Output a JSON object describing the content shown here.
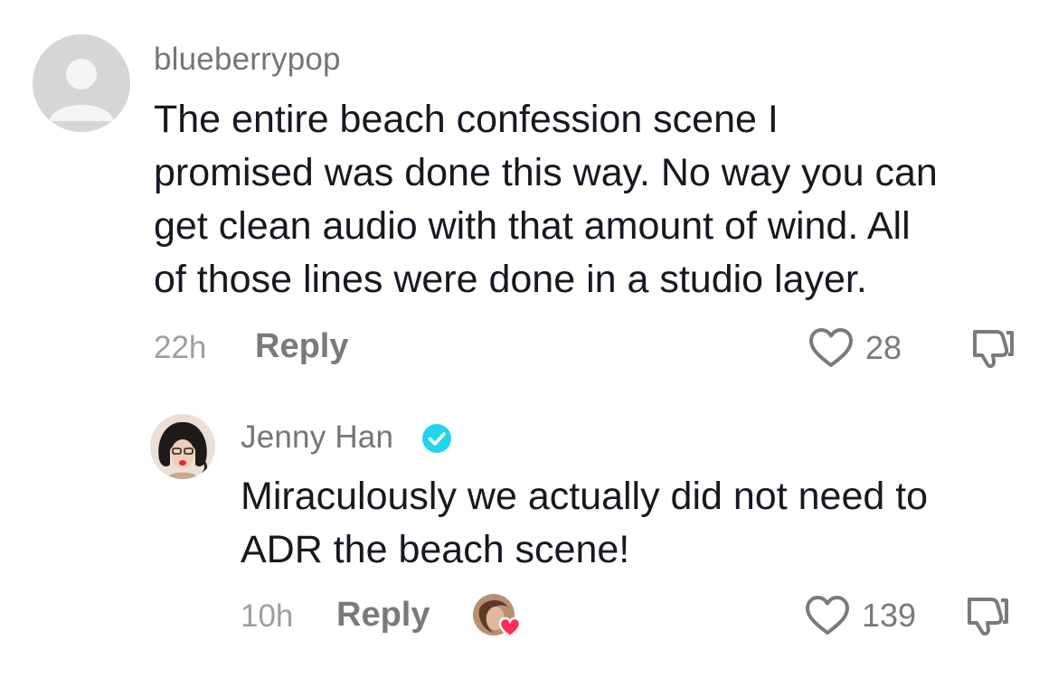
{
  "comments": [
    {
      "username": "blueberrypop",
      "text": "The entire beach confession scene I\npromised was done this way. No way you can\nget clean audio with that amount of wind. All\nof those lines were done in a studio layer.",
      "time": "22h",
      "reply_label": "Reply",
      "likes": "28",
      "avatar": "default-avatar-icon"
    }
  ],
  "replies": [
    {
      "username": "Jenny Han",
      "verified": true,
      "text": "Miraculously we actually did not need to\nADR the beach scene!",
      "time": "10h",
      "reply_label": "Reply",
      "likes": "139",
      "liked_by_creator": true
    }
  ],
  "icons": {
    "like": "heart-outline-icon",
    "dislike": "thumbs-down-icon",
    "verified": "verified-check-icon",
    "creator_like": "creator-heart-badge-icon"
  },
  "colors": {
    "verified": "#20d5ec",
    "creator_heart": "#fe2c55",
    "muted_text": "#7a7a7a"
  }
}
